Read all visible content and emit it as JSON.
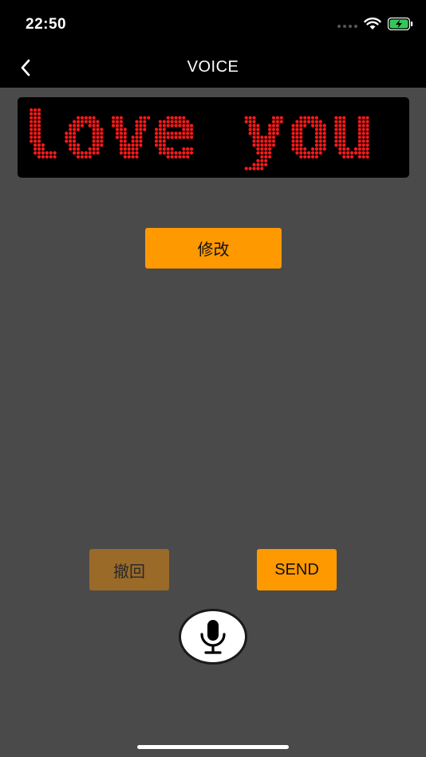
{
  "status_bar": {
    "time": "22:50"
  },
  "nav": {
    "title": "VOICE"
  },
  "led_display": {
    "text": "love you",
    "color": "#ff1a1a"
  },
  "buttons": {
    "edit_label": "修改",
    "undo_label": "撤回",
    "send_label": "SEND"
  },
  "colors": {
    "accent": "#ff9900",
    "undo_bg": "#9a6a28",
    "background": "#4a4a4a",
    "bar": "#000000"
  },
  "icons": {
    "back": "chevron-left-icon",
    "mic": "microphone-icon",
    "wifi": "wifi-icon",
    "battery": "battery-charging-icon"
  }
}
